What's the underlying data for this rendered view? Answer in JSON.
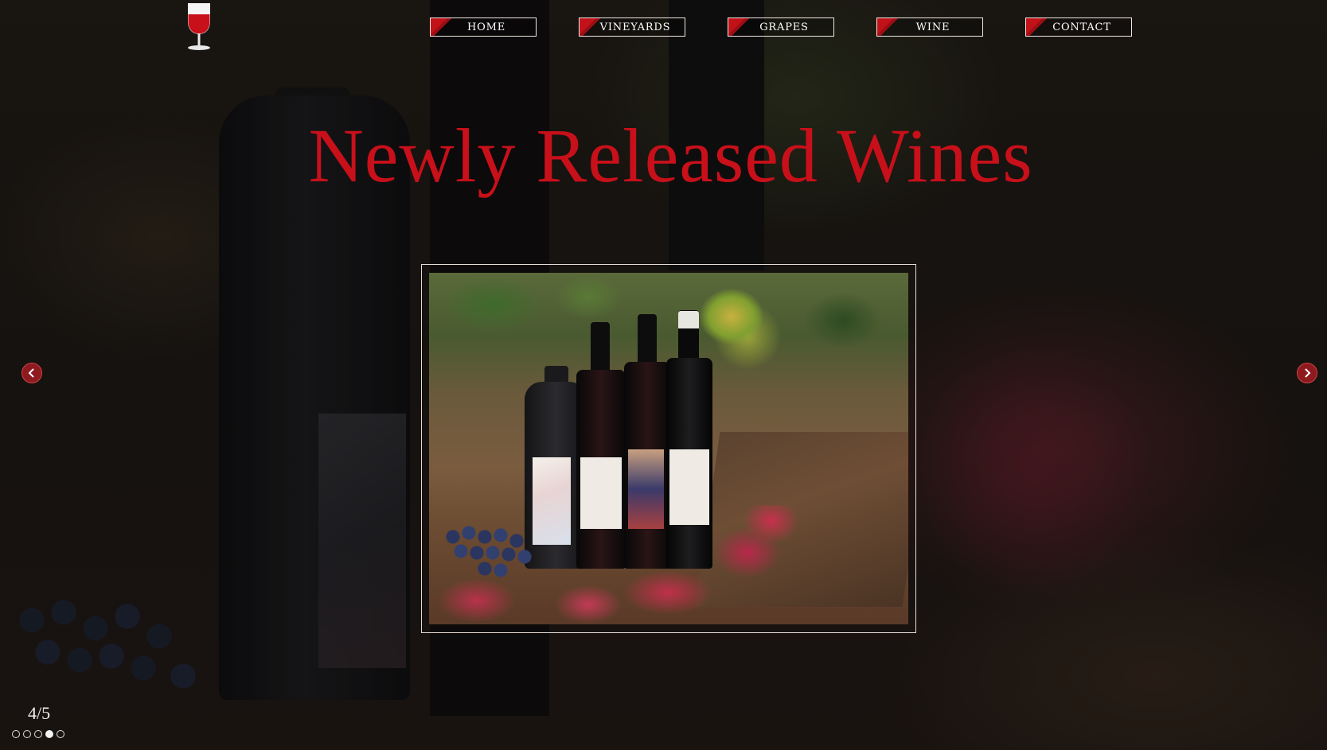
{
  "nav": {
    "items": [
      {
        "label": "HOME"
      },
      {
        "label": "VINEYARDS"
      },
      {
        "label": "GRAPES"
      },
      {
        "label": "WINE"
      },
      {
        "label": "CONTACT"
      }
    ]
  },
  "hero": {
    "title": "Newly Released Wines"
  },
  "slider": {
    "counter": "4/5",
    "current": 4,
    "total": 5
  },
  "icons": {
    "logo": "wine-glass-icon",
    "prev": "chevron-left-icon",
    "next": "chevron-right-icon"
  },
  "colors": {
    "accent": "#c8101a",
    "nav_border": "#f0e8e4",
    "arrow_bg": "#8e1a1f"
  }
}
